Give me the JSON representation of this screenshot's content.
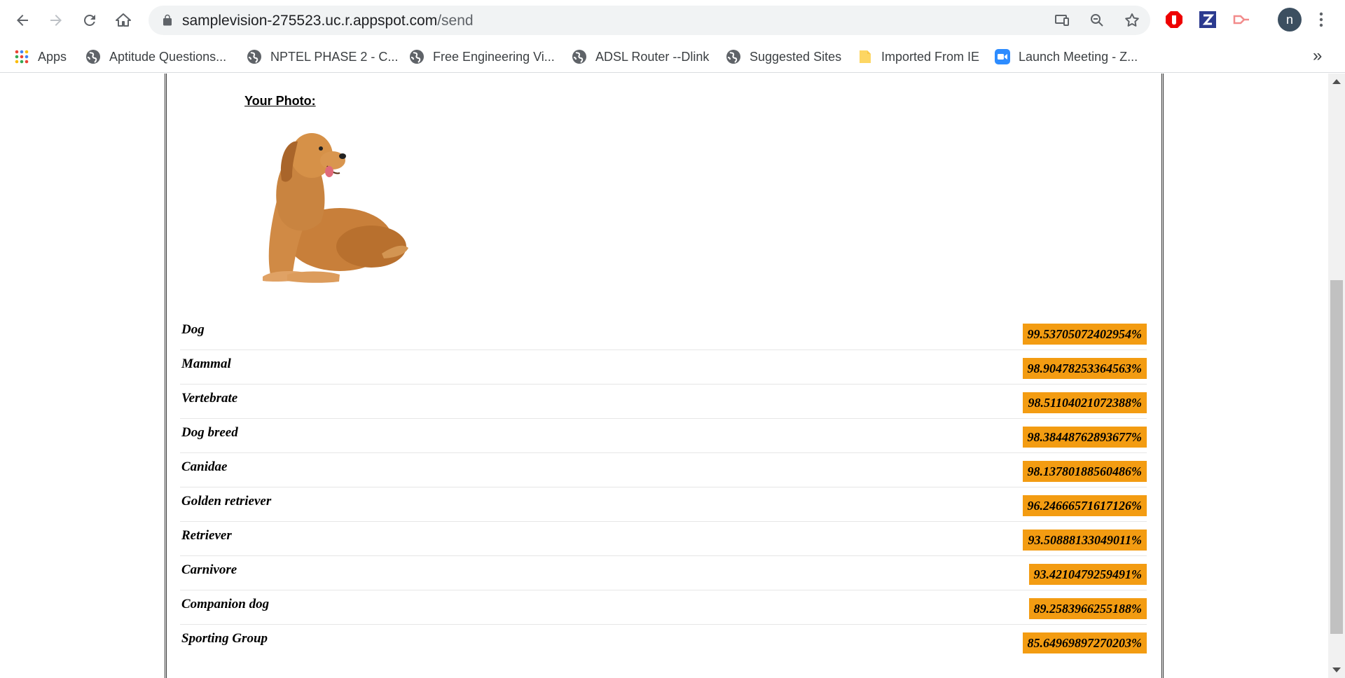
{
  "browser": {
    "url_host": "samplevision-275523.uc.r.appspot.com",
    "url_path": "/send",
    "avatar_letter": "n",
    "bookmarks_overflow": "»"
  },
  "bookmarks": [
    {
      "label": "Apps",
      "icon": "apps-grid-icon"
    },
    {
      "label": "Aptitude Questions...",
      "icon": "globe-icon"
    },
    {
      "label": "NPTEL PHASE 2 - C...",
      "icon": "globe-icon"
    },
    {
      "label": "Free Engineering Vi...",
      "icon": "globe-icon"
    },
    {
      "label": "ADSL Router --Dlink",
      "icon": "globe-icon"
    },
    {
      "label": "Suggested Sites",
      "icon": "globe-icon"
    },
    {
      "label": "Imported From IE",
      "icon": "folder-icon"
    },
    {
      "label": "Launch Meeting - Z...",
      "icon": "zoom-video-icon"
    }
  ],
  "page": {
    "photo_label": "Your Photo:",
    "photo_alt": "golden-retriever-dog"
  },
  "results": [
    {
      "label": "Dog",
      "score": "99.53705072402954%"
    },
    {
      "label": "Mammal",
      "score": "98.90478253364563%"
    },
    {
      "label": "Vertebrate",
      "score": "98.51104021072388%"
    },
    {
      "label": "Dog breed",
      "score": "98.38448762893677%"
    },
    {
      "label": "Canidae",
      "score": "98.13780188560486%"
    },
    {
      "label": "Golden retriever",
      "score": "96.24666571617126%"
    },
    {
      "label": "Retriever",
      "score": "93.50888133049011%"
    },
    {
      "label": "Carnivore",
      "score": "93.4210479259491%"
    },
    {
      "label": "Companion dog",
      "score": "89.2583966255188%"
    },
    {
      "label": "Sporting Group",
      "score": "85.64969897270203%"
    }
  ],
  "colors": {
    "score_badge": "#f39c12",
    "chrome_bg": "#ffffff",
    "omnibox_bg": "#f1f3f4"
  }
}
